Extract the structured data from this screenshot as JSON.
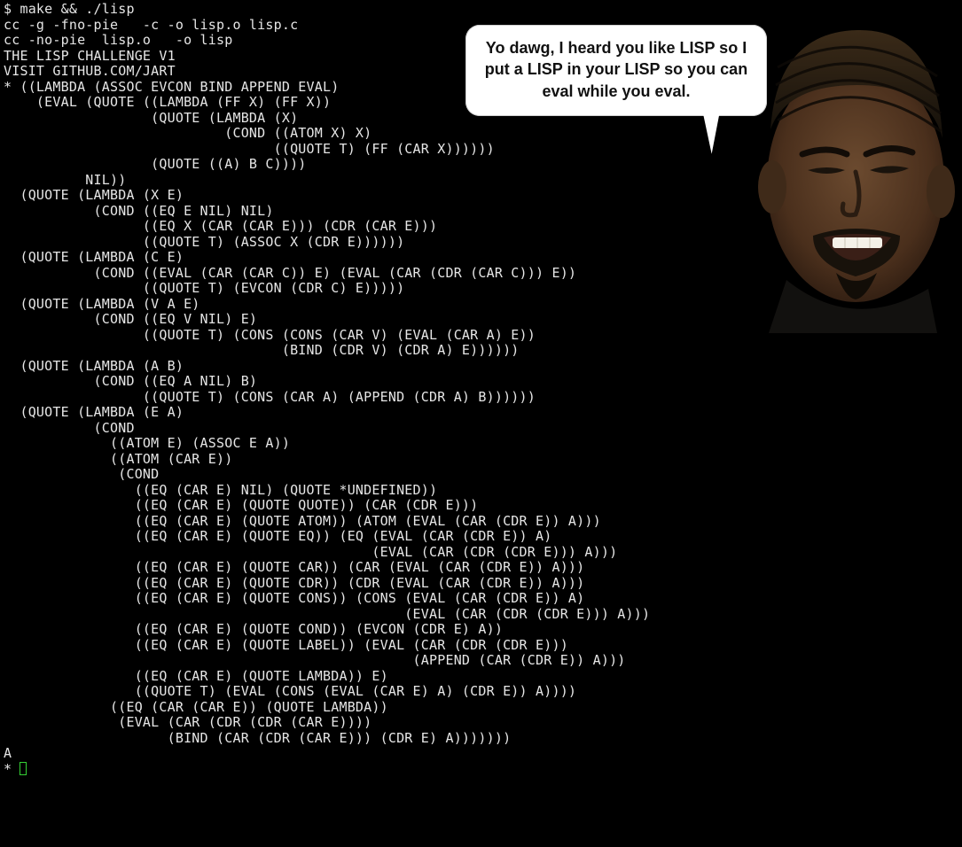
{
  "terminal": {
    "lines": [
      "$ make && ./lisp",
      "cc -g -fno-pie   -c -o lisp.o lisp.c",
      "cc -no-pie  lisp.o   -o lisp",
      "THE LISP CHALLENGE V1",
      "VISIT GITHUB.COM/JART",
      "* ((LAMBDA (ASSOC EVCON BIND APPEND EVAL)",
      "    (EVAL (QUOTE ((LAMBDA (FF X) (FF X))",
      "                  (QUOTE (LAMBDA (X)",
      "                           (COND ((ATOM X) X)",
      "                                 ((QUOTE T) (FF (CAR X))))))",
      "                  (QUOTE ((A) B C))))",
      "          NIL))",
      "  (QUOTE (LAMBDA (X E)",
      "           (COND ((EQ E NIL) NIL)",
      "                 ((EQ X (CAR (CAR E))) (CDR (CAR E)))",
      "                 ((QUOTE T) (ASSOC X (CDR E))))))",
      "  (QUOTE (LAMBDA (C E)",
      "           (COND ((EVAL (CAR (CAR C)) E) (EVAL (CAR (CDR (CAR C))) E))",
      "                 ((QUOTE T) (EVCON (CDR C) E)))))",
      "  (QUOTE (LAMBDA (V A E)",
      "           (COND ((EQ V NIL) E)",
      "                 ((QUOTE T) (CONS (CONS (CAR V) (EVAL (CAR A) E))",
      "                                  (BIND (CDR V) (CDR A) E))))))",
      "  (QUOTE (LAMBDA (A B)",
      "           (COND ((EQ A NIL) B)",
      "                 ((QUOTE T) (CONS (CAR A) (APPEND (CDR A) B))))))",
      "  (QUOTE (LAMBDA (E A)",
      "           (COND",
      "             ((ATOM E) (ASSOC E A))",
      "             ((ATOM (CAR E))",
      "              (COND",
      "                ((EQ (CAR E) NIL) (QUOTE *UNDEFINED))",
      "                ((EQ (CAR E) (QUOTE QUOTE)) (CAR (CDR E)))",
      "                ((EQ (CAR E) (QUOTE ATOM)) (ATOM (EVAL (CAR (CDR E)) A)))",
      "                ((EQ (CAR E) (QUOTE EQ)) (EQ (EVAL (CAR (CDR E)) A)",
      "                                             (EVAL (CAR (CDR (CDR E))) A)))",
      "                ((EQ (CAR E) (QUOTE CAR)) (CAR (EVAL (CAR (CDR E)) A)))",
      "                ((EQ (CAR E) (QUOTE CDR)) (CDR (EVAL (CAR (CDR E)) A)))",
      "                ((EQ (CAR E) (QUOTE CONS)) (CONS (EVAL (CAR (CDR E)) A)",
      "                                                 (EVAL (CAR (CDR (CDR E))) A)))",
      "                ((EQ (CAR E) (QUOTE COND)) (EVCON (CDR E) A))",
      "                ((EQ (CAR E) (QUOTE LABEL)) (EVAL (CAR (CDR (CDR E)))",
      "                                                  (APPEND (CAR (CDR E)) A)))",
      "                ((EQ (CAR E) (QUOTE LAMBDA)) E)",
      "                ((QUOTE T) (EVAL (CONS (EVAL (CAR E) A) (CDR E)) A))))",
      "             ((EQ (CAR (CAR E)) (QUOTE LAMBDA))",
      "              (EVAL (CAR (CDR (CDR (CAR E))))",
      "                    (BIND (CAR (CDR (CAR E))) (CDR E) A)))))))",
      "A"
    ],
    "prompt": "* "
  },
  "meme": {
    "text": "Yo dawg, I heard you like LISP so I put a LISP in your LISP so you can eval while you eval."
  }
}
